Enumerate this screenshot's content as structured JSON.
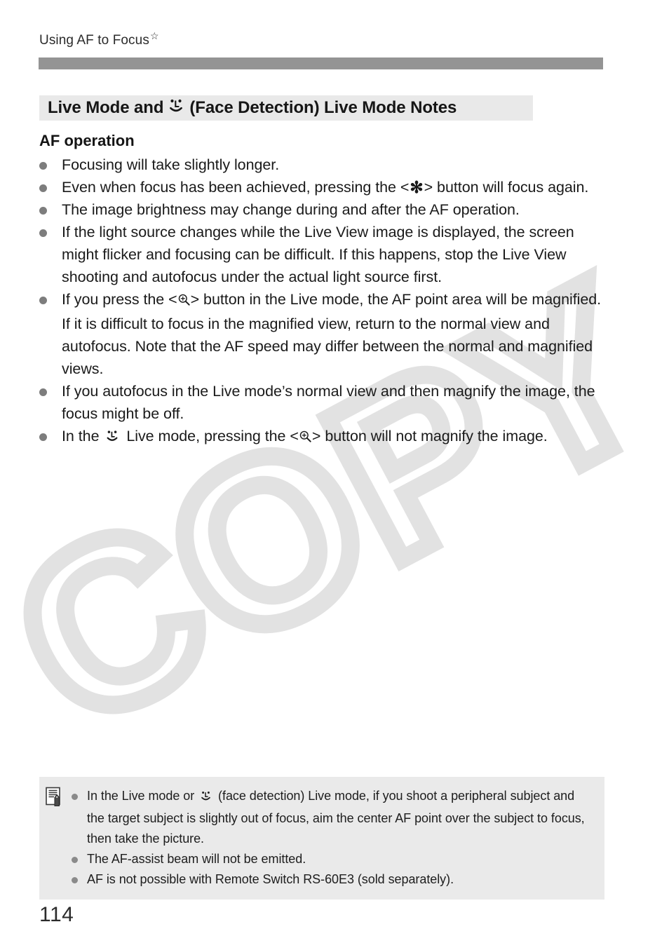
{
  "page": {
    "running_header": "Using AF to Focus",
    "running_header_star": "☆",
    "page_number": "114",
    "watermark": "COPY"
  },
  "section": {
    "heading_before_icon": "Live Mode and ",
    "heading_icon": "face-detection-icon",
    "heading_after_icon": " (Face Detection) Live Mode Notes",
    "sub_heading": "AF operation"
  },
  "bullets": [
    {
      "id": "focusing-longer",
      "parts": [
        {
          "type": "text",
          "value": "Focusing will take slightly longer."
        }
      ]
    },
    {
      "id": "ae-lock-refocus",
      "parts": [
        {
          "type": "text",
          "value": "Even when focus has been achieved, pressing the <"
        },
        {
          "type": "symbol",
          "value": "ae-lock-asterisk-icon"
        },
        {
          "type": "text",
          "value": "> button will focus again."
        }
      ]
    },
    {
      "id": "brightness-change",
      "parts": [
        {
          "type": "text",
          "value": "The image brightness may change during and after the AF operation."
        }
      ]
    },
    {
      "id": "light-source-change",
      "parts": [
        {
          "type": "text",
          "value": "If the light source changes while the Live View image is displayed, the screen might flicker and focusing can be difficult. If this happens, stop the Live View shooting and autofocus under the actual light source first."
        }
      ]
    },
    {
      "id": "magnify-af-point",
      "parts": [
        {
          "type": "text",
          "value": "If you press the <"
        },
        {
          "type": "symbol",
          "value": "magnify-icon"
        },
        {
          "type": "text",
          "value": "> button in the Live mode, the AF point area will be magnified. If it is difficult to focus in the magnified view, return to the normal view and autofocus. Note that the AF speed may differ between the normal and magnified views."
        }
      ]
    },
    {
      "id": "focus-might-be-off",
      "parts": [
        {
          "type": "text",
          "value": "If you autofocus in the Live mode’s normal view and then magnify the image, the focus might be off."
        }
      ]
    },
    {
      "id": "face-mode-no-magnify",
      "parts": [
        {
          "type": "text",
          "value": "In the "
        },
        {
          "type": "symbol",
          "value": "face-detection-icon"
        },
        {
          "type": "text",
          "value": " Live mode, pressing the <"
        },
        {
          "type": "symbol",
          "value": "magnify-icon"
        },
        {
          "type": "text",
          "value": "> button will not magnify the image."
        }
      ]
    }
  ],
  "note_box": {
    "icon": "note-pencil-icon",
    "items": [
      {
        "id": "peripheral-subject",
        "parts": [
          {
            "type": "text",
            "value": "In the Live mode or "
          },
          {
            "type": "symbol",
            "value": "face-detection-icon"
          },
          {
            "type": "text",
            "value": " (face detection) Live mode, if you shoot a peripheral subject and the target subject is slightly out of focus, aim the center AF point over the subject to focus, then take the picture."
          }
        ]
      },
      {
        "id": "af-assist-beam",
        "parts": [
          {
            "type": "text",
            "value": "The AF-assist beam will not be emitted."
          }
        ]
      },
      {
        "id": "remote-switch",
        "parts": [
          {
            "type": "text",
            "value": "AF is not possible with Remote Switch RS-60E3 (sold separately)."
          }
        ]
      }
    ]
  },
  "colors": {
    "header_rule": "#949494",
    "heading_bg": "#e9e9e9",
    "note_bg": "#eaeaea",
    "bullet": "#7d7d7d",
    "watermark": "#e2e2e2",
    "text": "#1a1a1a"
  }
}
